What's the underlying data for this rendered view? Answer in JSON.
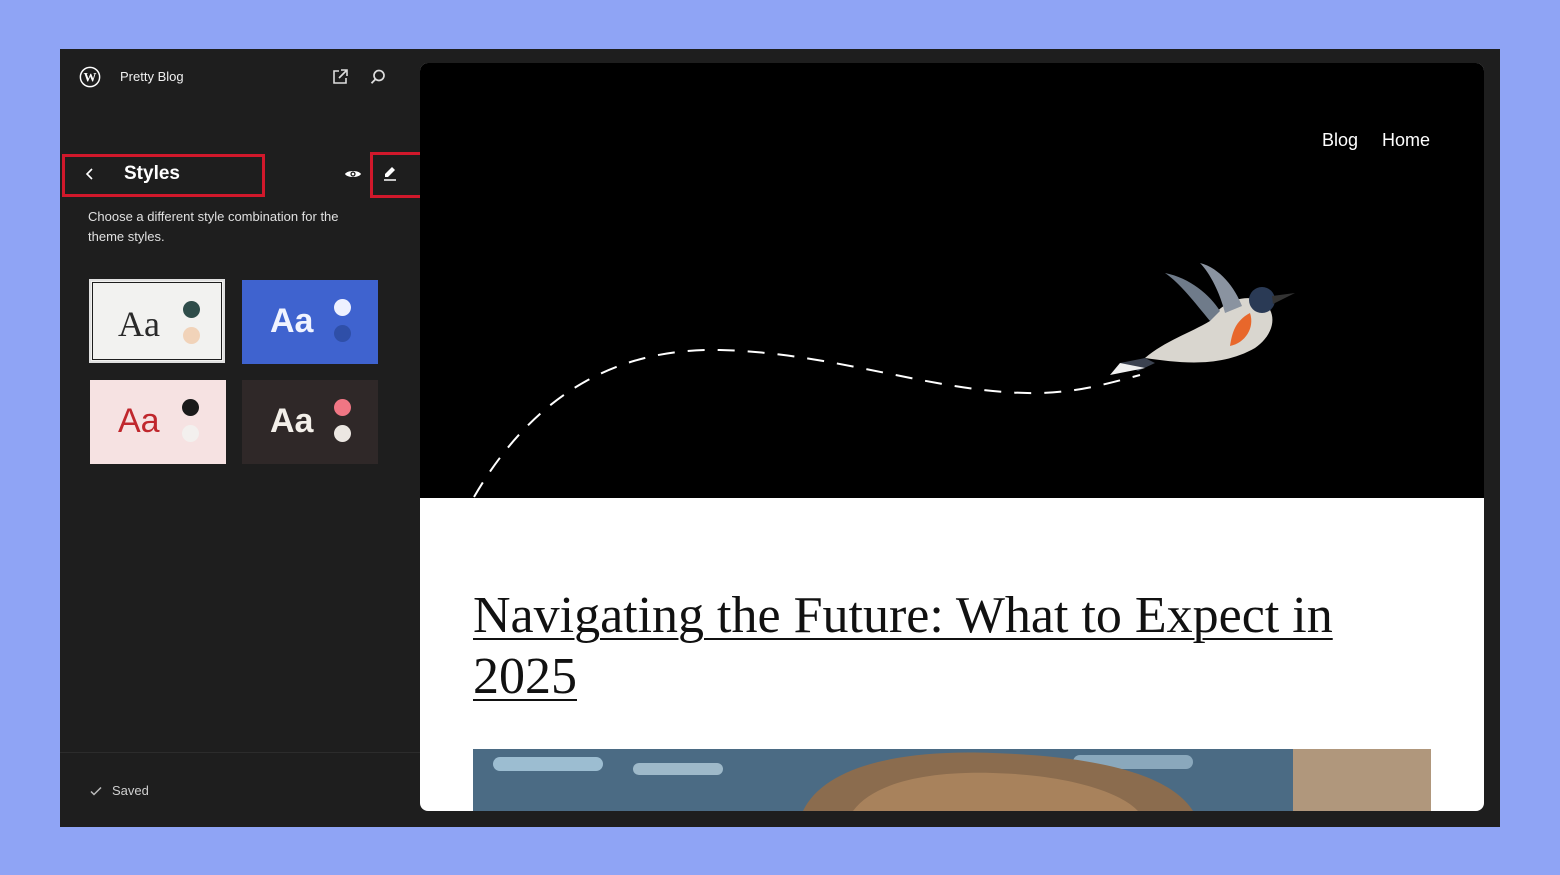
{
  "sidebar": {
    "site_title": "Pretty Blog",
    "panel_title": "Styles",
    "description": "Choose a different style combination for the theme styles.",
    "variations": [
      {
        "label": "Aa",
        "dot1": "#2f4d4a",
        "dot2": "#f1d3b9",
        "bg": "#f2f2f0"
      },
      {
        "label": "Aa",
        "dot1": "#eef1ff",
        "dot2": "#2f4fa8",
        "bg": "#3f63cf"
      },
      {
        "label": "Aa",
        "dot1": "#1a1a1a",
        "dot2": "#f3f0ee",
        "bg": "#f6e2e2"
      },
      {
        "label": "Aa",
        "dot1": "#f07684",
        "dot2": "#ece7e2",
        "bg": "#2f2828"
      }
    ],
    "status": "Saved"
  },
  "icons": {
    "logo": "wordpress-logo-icon",
    "external": "external-link-icon",
    "search": "search-icon",
    "back": "chevron-left-icon",
    "preview": "eye-icon",
    "edit": "pencil-icon",
    "check": "check-icon"
  },
  "preview": {
    "nav": [
      "Blog",
      "Home"
    ],
    "post_title": "Navigating the Future: What to Expect in 2025"
  },
  "colors": {
    "highlight": "#d1182b",
    "page_bg": "#8fa4f5",
    "sidebar_bg": "#1e1e1e"
  }
}
